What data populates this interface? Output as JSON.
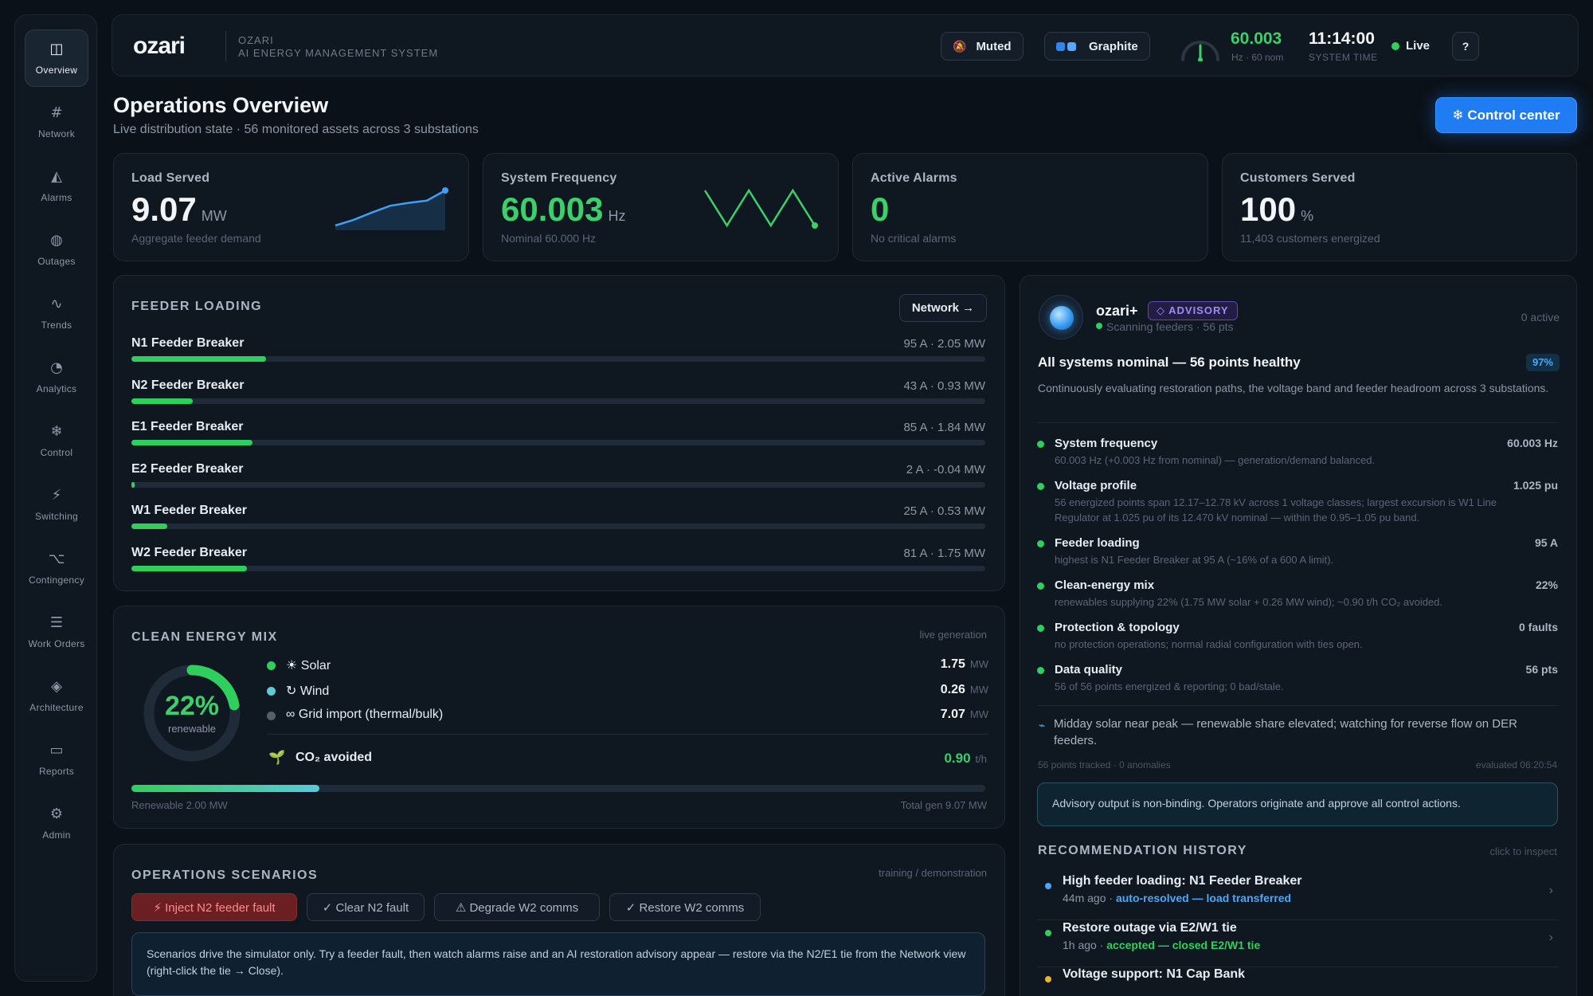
{
  "sidebar": {
    "items": [
      {
        "label": "Overview",
        "icon": "◫",
        "icon_name": "layout-icon"
      },
      {
        "label": "Network",
        "icon": "#",
        "icon_name": "grid-icon"
      },
      {
        "label": "Alarms",
        "icon": "◭",
        "icon_name": "warning-icon"
      },
      {
        "label": "Outages",
        "icon": "◍",
        "icon_name": "globe-icon"
      },
      {
        "label": "Trends",
        "icon": "∿",
        "icon_name": "wave-icon"
      },
      {
        "label": "Analytics",
        "icon": "◔",
        "icon_name": "pie-icon"
      },
      {
        "label": "Control",
        "icon": "❄",
        "icon_name": "snowflake-icon"
      },
      {
        "label": "Switching",
        "icon": "⚡",
        "icon_name": "bolt-icon"
      },
      {
        "label": "Contingency",
        "icon": "⌥",
        "icon_name": "branch-icon"
      },
      {
        "label": "Work Orders",
        "icon": "☰",
        "icon_name": "list-icon"
      },
      {
        "label": "Architecture",
        "icon": "◈",
        "icon_name": "diamond-icon"
      },
      {
        "label": "Reports",
        "icon": "▭",
        "icon_name": "report-icon"
      },
      {
        "label": "Admin",
        "icon": "⚙",
        "icon_name": "gear-icon"
      }
    ]
  },
  "header": {
    "logo": "ozari",
    "brand_line1": "OZARI",
    "brand_line2": "AI ENERGY MANAGEMENT SYSTEM",
    "muted_label": "Muted",
    "muted_icon": "🔕",
    "theme_label": "Graphite",
    "frequency": "60.003",
    "frequency_sub": "Hz · 60 nom",
    "time": "11:14:00",
    "time_sub": "SYSTEM TIME",
    "live_label": "Live",
    "help_label": "?",
    "gauge_fraction": 0.5
  },
  "page": {
    "title": "Operations Overview",
    "subtitle": "Live distribution state · 56 monitored assets across 3 substations",
    "control_button": "❄ Control center"
  },
  "kpis": [
    {
      "label": "Load Served",
      "value": "9.07",
      "unit": "MW",
      "note": "Aggregate feeder demand",
      "spark": [
        2,
        3,
        4.3,
        5.5,
        6,
        6.4,
        8.2
      ]
    },
    {
      "label": "System Frequency",
      "value": "60.003",
      "unit": "Hz",
      "note": "Nominal 60.000 Hz",
      "spark": [
        5,
        2,
        5,
        2,
        5,
        2
      ]
    },
    {
      "label": "Active Alarms",
      "value": "0",
      "unit": "",
      "note": "No critical alarms"
    },
    {
      "label": "Customers Served",
      "value": "100",
      "unit": "%",
      "note": "11,403 customers energized"
    }
  ],
  "feeder_loading": {
    "title": "FEEDER LOADING",
    "network_button": "Network →",
    "feeders": [
      {
        "name": "N1 Feeder Breaker",
        "reading": "95 A · 2.05 MW",
        "fraction": 0.158
      },
      {
        "name": "N2 Feeder Breaker",
        "reading": "43 A · 0.93 MW",
        "fraction": 0.072
      },
      {
        "name": "E1 Feeder Breaker",
        "reading": "85 A · 1.84 MW",
        "fraction": 0.142
      },
      {
        "name": "E2 Feeder Breaker",
        "reading": "2 A · -0.04 MW",
        "fraction": 0.004
      },
      {
        "name": "W1 Feeder Breaker",
        "reading": "25 A · 0.53 MW",
        "fraction": 0.042
      },
      {
        "name": "W2 Feeder Breaker",
        "reading": "81 A · 1.75 MW",
        "fraction": 0.135
      }
    ]
  },
  "clean_mix": {
    "title": "CLEAN ENERGY MIX",
    "tag": "live generation",
    "renewable_pct": "22%",
    "renewable_label": "renewable",
    "renewable_fraction": 0.22,
    "rows": [
      {
        "name": "☀ Solar",
        "value": "1.75",
        "unit": "MW",
        "color": "#2fcf5e"
      },
      {
        "name": "↻ Wind",
        "value": "0.26",
        "unit": "MW",
        "color": "#5cc8d8"
      },
      {
        "name": "∞ Grid import (thermal/bulk)",
        "value": "7.07",
        "unit": "MW",
        "color": "#555f6b"
      }
    ],
    "co2_label": "CO₂ avoided",
    "co2_value": "0.90",
    "co2_unit": "t/h",
    "bar_fraction": 0.22,
    "renewable_total": "Renewable 2.00 MW",
    "total_gen": "Total gen 9.07 MW"
  },
  "scenarios": {
    "title": "OPERATIONS SCENARIOS",
    "tag": "training / demonstration",
    "buttons": [
      "⚡ Inject N2 feeder fault",
      "✓ Clear N2 fault",
      "⚠ Degrade W2 comms",
      "✓ Restore W2 comms"
    ],
    "info": "Scenarios drive the simulator only. Try a feeder fault, then watch alarms raise and an AI restoration advisory appear — restore via the N2/E1 tie from the Network view (right-click the tie → Close)."
  },
  "advisor": {
    "name": "ozari+",
    "badge": "◇ ADVISORY",
    "status": "Scanning feeders · 56 pts",
    "active": "0 active",
    "headline": "All systems nominal — 56 points healthy",
    "confidence": "97%",
    "summary": "Continuously evaluating restoration paths, the voltage band and feeder headroom across 3 substations.",
    "checks": [
      {
        "title": "System frequency",
        "value": "60.003 Hz",
        "desc": "60.003 Hz (+0.003 Hz from nominal) — generation/demand balanced."
      },
      {
        "title": "Voltage profile",
        "value": "1.025 pu",
        "desc": "56 energized points span 12.17–12.78 kV across 1 voltage classes; largest excursion is W1 Line Regulator at 1.025 pu of its 12.470 kV nominal — within the 0.95–1.05 pu band."
      },
      {
        "title": "Feeder loading",
        "value": "95 A",
        "desc": "highest is N1 Feeder Breaker at 95 A (~16% of a 600 A limit)."
      },
      {
        "title": "Clean-energy mix",
        "value": "22%",
        "desc": "renewables supplying 22% (1.75 MW solar + 0.26 MW wind); ~0.90 t/h CO₂ avoided."
      },
      {
        "title": "Protection & topology",
        "value": "0 faults",
        "desc": "no protection operations; normal radial configuration with ties open."
      },
      {
        "title": "Data quality",
        "value": "56 pts",
        "desc": "56 of 56 points energized & reporting; 0 bad/stale."
      }
    ],
    "note": "Midday solar near peak — renewable share elevated; watching for reverse flow on DER feeders.",
    "tracked": "56 points tracked · 0 anomalies",
    "evaluated": "evaluated 06:20:54",
    "disclaimer": "Advisory output is non-binding. Operators originate and approve all control actions."
  },
  "history": {
    "title": "RECOMMENDATION HISTORY",
    "tag": "click to inspect",
    "items": [
      {
        "title": "High feeder loading: N1 Feeder Breaker",
        "age": "44m ago · ",
        "outcome": "auto-resolved — load transferred",
        "color": "#4aa8ff"
      },
      {
        "title": "Restore outage via E2/W1 tie",
        "age": "1h ago · ",
        "outcome": "accepted — closed E2/W1 tie",
        "color": "#2fcf5e"
      },
      {
        "title": "Voltage support: N1 Cap Bank",
        "age": "",
        "outcome": "",
        "color": "#f0b429"
      }
    ]
  }
}
